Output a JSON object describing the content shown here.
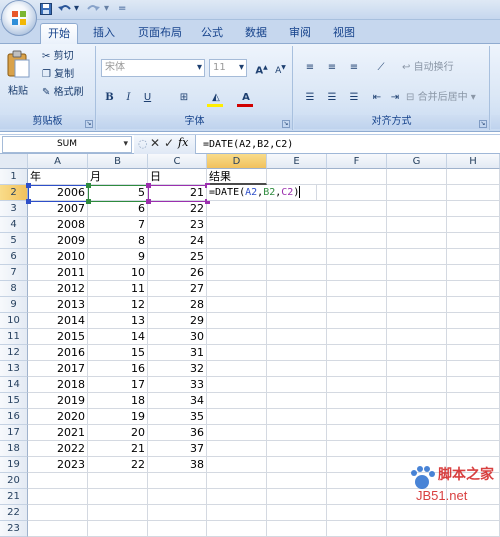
{
  "quick_access": {
    "save_icon": "save-icon",
    "undo_icon": "undo-icon",
    "redo_icon": "redo-icon",
    "customize_glyph": "="
  },
  "tabs": [
    "开始",
    "插入",
    "页面布局",
    "公式",
    "数据",
    "审阅",
    "视图"
  ],
  "active_tab": "开始",
  "ribbon": {
    "clipboard": {
      "label": "剪贴板",
      "paste": "粘贴",
      "cut": "剪切",
      "copy": "复制",
      "format_painter": "格式刷"
    },
    "font": {
      "label": "字体",
      "font_name": "宋体",
      "font_size": "11",
      "bold": "B",
      "italic": "I",
      "underline": "U",
      "grow": "A",
      "shrink": "A"
    },
    "alignment": {
      "label": "对齐方式",
      "wrap_text": "自动换行",
      "merge_center": "合并后居中"
    }
  },
  "formula_bar": {
    "name_box": "SUM",
    "cancel": "✕",
    "enter": "✓",
    "fx": "fx",
    "formula": "=DATE(A2,B2,C2)"
  },
  "columns": [
    "A",
    "B",
    "C",
    "D",
    "E",
    "F",
    "G",
    "H"
  ],
  "row_numbers": [
    "1",
    "2",
    "3",
    "4",
    "5",
    "6",
    "7",
    "8",
    "9",
    "10",
    "11",
    "12",
    "13",
    "14",
    "15",
    "16",
    "17",
    "18",
    "19",
    "20",
    "21",
    "22",
    "23"
  ],
  "headers": {
    "a": "年",
    "b": "月",
    "c": "日",
    "d": "结果"
  },
  "rows": [
    {
      "a": "2006",
      "b": "5",
      "c": "21"
    },
    {
      "a": "2007",
      "b": "6",
      "c": "22"
    },
    {
      "a": "2008",
      "b": "7",
      "c": "23"
    },
    {
      "a": "2009",
      "b": "8",
      "c": "24"
    },
    {
      "a": "2010",
      "b": "9",
      "c": "25"
    },
    {
      "a": "2011",
      "b": "10",
      "c": "26"
    },
    {
      "a": "2012",
      "b": "11",
      "c": "27"
    },
    {
      "a": "2013",
      "b": "12",
      "c": "28"
    },
    {
      "a": "2014",
      "b": "13",
      "c": "29"
    },
    {
      "a": "2015",
      "b": "14",
      "c": "30"
    },
    {
      "a": "2016",
      "b": "15",
      "c": "31"
    },
    {
      "a": "2017",
      "b": "16",
      "c": "32"
    },
    {
      "a": "2018",
      "b": "17",
      "c": "33"
    },
    {
      "a": "2019",
      "b": "18",
      "c": "34"
    },
    {
      "a": "2020",
      "b": "19",
      "c": "35"
    },
    {
      "a": "2021",
      "b": "20",
      "c": "36"
    },
    {
      "a": "2022",
      "b": "21",
      "c": "37"
    },
    {
      "a": "2023",
      "b": "22",
      "c": "38"
    }
  ],
  "editing_cell": {
    "prefix": "=DATE(",
    "ref_a": "A2",
    "ref_b": "B2",
    "ref_c": "C2",
    "sep": ",",
    "suffix": ")"
  },
  "watermark": {
    "line1": "脚本之家",
    "line2": "JB51.net"
  },
  "colors": {
    "ref_a": "#2e4fc9",
    "ref_b": "#2e8b3e",
    "ref_c": "#9b2fae",
    "ribbon_text": "#15428b"
  }
}
